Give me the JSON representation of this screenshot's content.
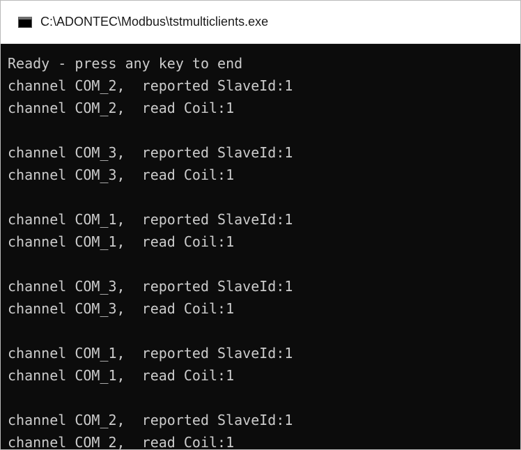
{
  "window": {
    "title": "C:\\ADONTEC\\Modbus\\tstmulticlients.exe",
    "icon": "console-app-icon"
  },
  "console": {
    "lines": [
      "Ready - press any key to end",
      "channel COM_2,  reported SlaveId:1",
      "channel COM_2,  read Coil:1",
      "",
      "channel COM_3,  reported SlaveId:1",
      "channel COM_3,  read Coil:1",
      "",
      "channel COM_1,  reported SlaveId:1",
      "channel COM_1,  read Coil:1",
      "",
      "channel COM_3,  reported SlaveId:1",
      "channel COM_3,  read Coil:1",
      "",
      "channel COM_1,  reported SlaveId:1",
      "channel COM_1,  read Coil:1",
      "",
      "channel COM_2,  reported SlaveId:1",
      "channel COM_2,  read Coil:1"
    ]
  },
  "colors": {
    "background": "#0c0c0c",
    "text": "#cccccc",
    "titlebar": "#ffffff"
  }
}
